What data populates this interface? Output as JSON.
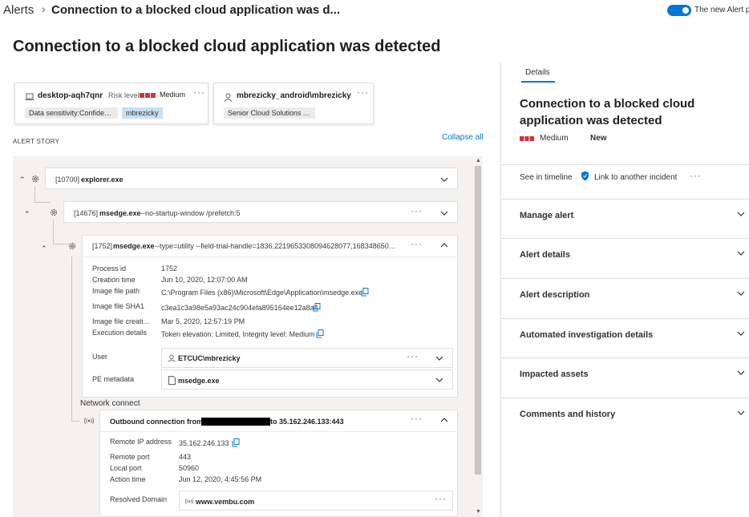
{
  "breadcrumb": {
    "root": "Alerts",
    "current": "Connection to a blocked cloud application was d..."
  },
  "toggle": {
    "label": "The new Alert p",
    "on": true
  },
  "page_title": "Connection to a blocked cloud application was detected",
  "cards": {
    "device": {
      "name": "desktop-aqh7qnr",
      "risk_label": "Risk level",
      "risk_value": "Medium",
      "tags": [
        "Data sensitivity:Confident...",
        "mbrezicky"
      ]
    },
    "user": {
      "name": "mbrezicky_android\\mbrezicky",
      "tags": [
        "Senior Cloud Solutions A..."
      ]
    }
  },
  "alert_story": {
    "header": "ALERT STORY",
    "collapse_all": "Collapse all"
  },
  "processes": [
    {
      "pid": "[10700]",
      "name": "explorer.exe",
      "args": ""
    },
    {
      "pid": "[14676]",
      "name": "msedge.exe",
      "args": "--no-startup-window /prefetch:5"
    },
    {
      "pid": "[1752]",
      "name": "msedge.exe",
      "args": "--type=utility --field-trial-handle=1836,2219653308094628077,16834865047..."
    }
  ],
  "process_details": [
    {
      "label": "Process id",
      "value": "1752"
    },
    {
      "label": "Creation time",
      "value": "Jun 10, 2020, 12:07:00 AM"
    },
    {
      "label": "Image file path",
      "value": "C:\\Program Files (x86)\\Microsoft\\Edge\\Application\\msedge.exe"
    },
    {
      "label": "Image file SHA1",
      "value": "c3ea1c3a98e5a93ac24c904efa895164ee12a8a4"
    },
    {
      "label": "Image file creati...",
      "value": "Mar 5, 2020, 12:57:19 PM"
    },
    {
      "label": "Execution details",
      "value": "Token elevation: Limited, Integrity level: Medium"
    }
  ],
  "user_row": {
    "label": "User",
    "value": "ETCUC\\mbrezicky"
  },
  "pe_row": {
    "label": "PE metadata",
    "value": "msedge.exe"
  },
  "network": {
    "section_label": "Network connect",
    "title_prefix": "Outbound connection from",
    "title_suffix": "to 35.162.246.133:443",
    "details": [
      {
        "label": "Remote IP address",
        "value": "35.162.246.133"
      },
      {
        "label": "Remote port",
        "value": "443"
      },
      {
        "label": "Local port",
        "value": "50960"
      },
      {
        "label": "Action time",
        "value": "Jun 12, 2020, 4:45:56 PM"
      }
    ],
    "domain_label": "Resolved Domain",
    "domain_value": "www.vembu.com"
  },
  "panel": {
    "tab": "Details",
    "title": "Connection to a blocked cloud application was detected",
    "severity": "Medium",
    "status": "New",
    "actions": {
      "timeline": "See in timeline",
      "link": "Link to another incident"
    },
    "sections": [
      "Manage alert",
      "Alert details",
      "Alert description",
      "Automated investigation details",
      "Impacted assets",
      "Comments and history"
    ]
  },
  "colors": {
    "accent": "#0078d4",
    "severity": "#d13438"
  }
}
